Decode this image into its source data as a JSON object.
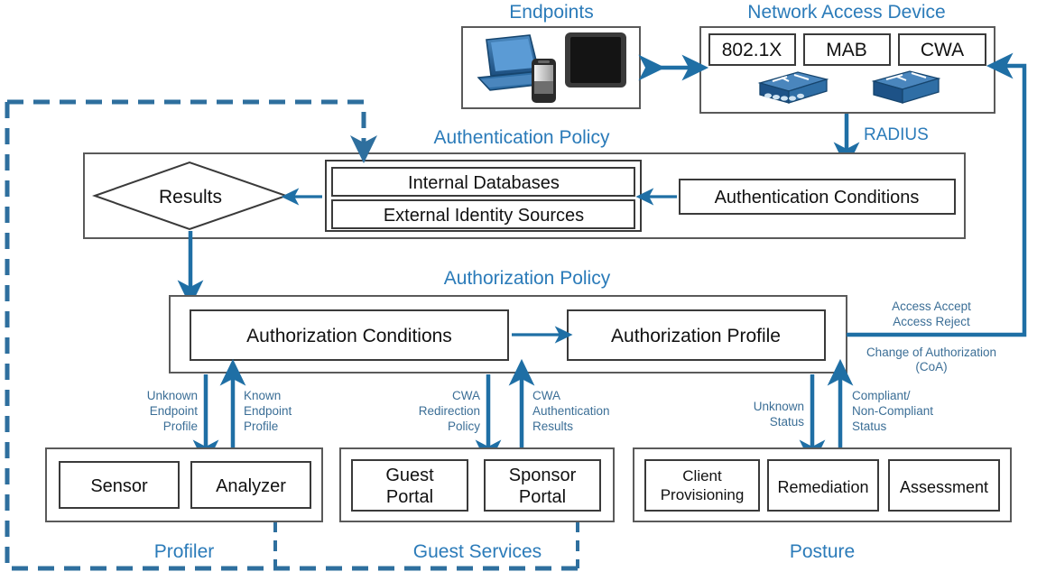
{
  "diagram": {
    "title_endpoints": "Endpoints",
    "title_nad": "Network Access Device",
    "title_auth_policy": "Authentication Policy",
    "title_authz_policy": "Authorization Policy",
    "radius_label": "RADIUS",
    "nad_methods": [
      "802.1X",
      "MAB",
      "CWA"
    ],
    "nad_icons": [
      "switch-icon-multiport",
      "switch-icon-plain"
    ],
    "endpoint_icons": [
      "laptop-icon",
      "smartphone-icon",
      "tablet-icon"
    ],
    "auth_policy": {
      "results_label": "Results",
      "sources": [
        "Internal Databases",
        "External Identity Sources"
      ],
      "conditions_label": "Authentication Conditions"
    },
    "authz_policy": {
      "conditions_label": "Authorization Conditions",
      "profile_label": "Authorization Profile"
    },
    "right_labels": {
      "access_accept": "Access Accept",
      "access_reject": "Access Reject",
      "coa_line1": "Change of Authorization",
      "coa_line2": "(CoA)"
    },
    "flow_labels": [
      {
        "id": "unknown-endpoint-profile",
        "lines": [
          "Unknown",
          "Endpoint",
          "Profile"
        ]
      },
      {
        "id": "known-endpoint-profile",
        "lines": [
          "Known",
          "Endpoint",
          "Profile"
        ]
      },
      {
        "id": "cwa-redirection-policy",
        "lines": [
          "CWA",
          "Redirection",
          "Policy"
        ]
      },
      {
        "id": "cwa-authentication-results",
        "lines": [
          "CWA",
          "Authentication",
          "Results"
        ]
      },
      {
        "id": "unknown-status",
        "lines": [
          "Unknown",
          "Status"
        ]
      },
      {
        "id": "compliant-status",
        "lines": [
          "Compliant/",
          "Non-Compliant",
          "Status"
        ]
      }
    ],
    "groups": [
      {
        "id": "profiler",
        "caption": "Profiler",
        "items": [
          [
            "Sensor"
          ],
          [
            "Analyzer"
          ]
        ]
      },
      {
        "id": "guest-services",
        "caption": "Guest Services",
        "items": [
          [
            "Guest",
            "Portal"
          ],
          [
            "Sponsor",
            "Portal"
          ]
        ]
      },
      {
        "id": "posture",
        "caption": "Posture",
        "items": [
          [
            "Client",
            "Provisioning"
          ],
          [
            "Remediation"
          ],
          [
            "Assessment"
          ]
        ]
      }
    ],
    "colors": {
      "accent_blue": "#1f6fa5",
      "title_blue": "#2b7bb9",
      "label_blue": "#3b6e96",
      "box_stroke": "#5a5a5a",
      "device_blue": "#2a6496"
    }
  }
}
